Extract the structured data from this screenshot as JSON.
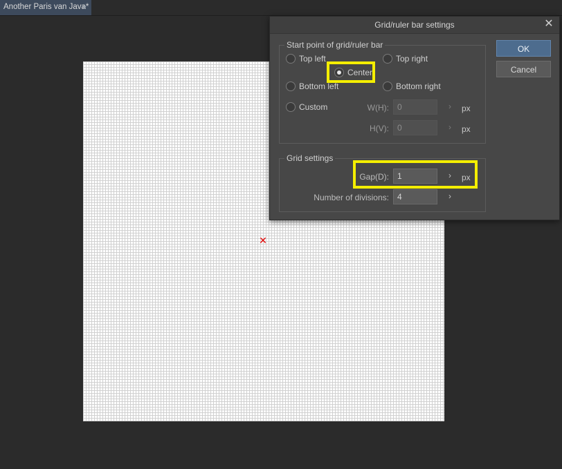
{
  "tabbar": {
    "document_tab": {
      "label": "Another Paris van Java*",
      "dot": "●"
    }
  },
  "dialog": {
    "title": "Grid/ruler bar settings",
    "close_glyph": "✕",
    "start_point": {
      "group_label": "Start point of grid/ruler bar",
      "options": [
        {
          "label": "Top left",
          "checked": false
        },
        {
          "label": "Top right",
          "checked": false
        },
        {
          "label": "Center",
          "checked": true
        },
        {
          "label": "Bottom left",
          "checked": false
        },
        {
          "label": "Bottom right",
          "checked": false
        },
        {
          "label": "Custom",
          "checked": false
        }
      ],
      "w_label": "W(H):",
      "w_value": "0",
      "h_label": "H(V):",
      "h_value": "0",
      "unit": "px"
    },
    "grid_settings": {
      "group_label": "Grid settings",
      "gap_label": "Gap(D):",
      "gap_value": "1",
      "gap_unit": "px",
      "divisions_label": "Number of divisions:",
      "divisions_value": "4"
    },
    "buttons": {
      "ok": "OK",
      "cancel": "Cancel"
    },
    "chevron_glyph": "›"
  },
  "canvas": {
    "center_mark": "✕",
    "center_mark_color": "#e00000"
  },
  "colors": {
    "highlight": "#f4ee00",
    "ok_button": "#4d6c8e",
    "tab_active": "#3d4a5c"
  }
}
